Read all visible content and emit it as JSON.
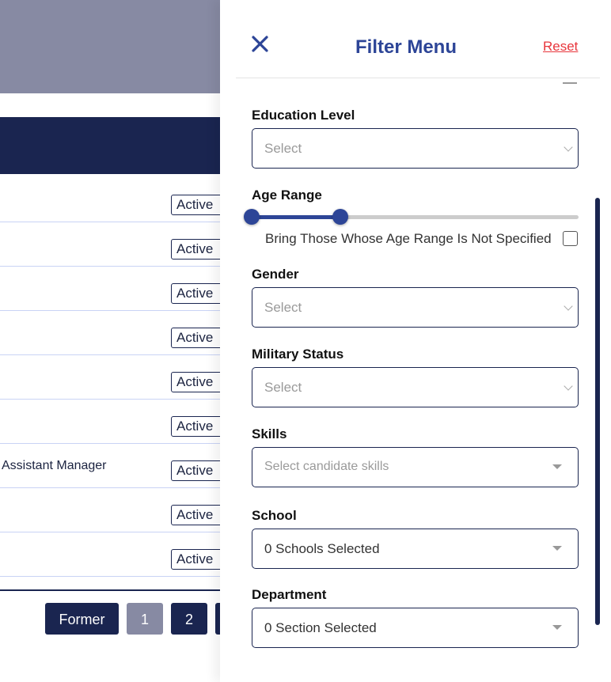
{
  "table": {
    "rows": [
      {
        "position": "",
        "status": "Active"
      },
      {
        "position": "",
        "status": "Active"
      },
      {
        "position": "",
        "status": "Active"
      },
      {
        "position": "",
        "status": "Active"
      },
      {
        "position": "",
        "status": "Active"
      },
      {
        "position": "",
        "status": "Active"
      },
      {
        "position": "Assistant Manager",
        "status": "Active"
      },
      {
        "position": "",
        "status": "Active"
      },
      {
        "position": "",
        "status": "Active"
      }
    ]
  },
  "pagination": {
    "former": "Former",
    "pages": [
      "1",
      "2"
    ],
    "current_page": "1"
  },
  "filter": {
    "title": "Filter Menu",
    "reset": "Reset",
    "close_icon": "close-icon",
    "education": {
      "label": "Education Level",
      "placeholder": "Select"
    },
    "age": {
      "label": "Age Range",
      "range_fraction": [
        0,
        0.27
      ],
      "unspecified_label": "Bring Those Whose Age Range Is Not Specified",
      "unspecified_checked": false
    },
    "gender": {
      "label": "Gender",
      "placeholder": "Select"
    },
    "military": {
      "label": "Military Status",
      "placeholder": "Select"
    },
    "skills": {
      "label": "Skills",
      "placeholder": "Select candidate skills"
    },
    "school": {
      "label": "School",
      "value": "0 Schools Selected"
    },
    "department": {
      "label": "Department",
      "value": "0 Section Selected"
    }
  },
  "colors": {
    "navy": "#1a2550",
    "accent": "#2d4597",
    "reset": "#e8363c",
    "overlay": "#878aa3"
  }
}
